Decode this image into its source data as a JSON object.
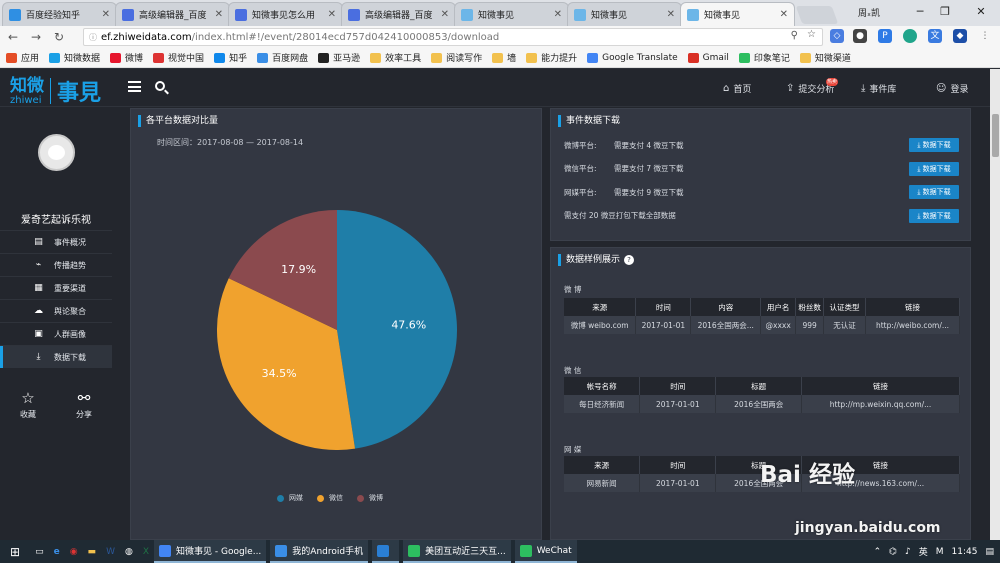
{
  "browser": {
    "tabs": [
      {
        "label": "百度经验知乎",
        "color": "#2f8fe3"
      },
      {
        "label": "高级编辑器_百度",
        "color": "#4a6ee0"
      },
      {
        "label": "知微事见怎么用",
        "color": "#4a6ee0"
      },
      {
        "label": "高级编辑器_百度",
        "color": "#4a6ee0"
      },
      {
        "label": "知微事见",
        "color": "#6cb6e8"
      },
      {
        "label": "知微事见",
        "color": "#6cb6e8"
      },
      {
        "label": "知微事见",
        "color": "#6cb6e8"
      }
    ],
    "user": "周ₓ凯",
    "url_host": "ef.zhiweidata.com",
    "url_path": "/index.html#!/event/28014ecd757d042410000853/download",
    "bookmarks": [
      {
        "label": "应用",
        "color": "#e44d26"
      },
      {
        "label": "知微数据",
        "color": "#1aa0e6"
      },
      {
        "label": "微博",
        "color": "#e6162d"
      },
      {
        "label": "视觉中国",
        "color": "#d33"
      },
      {
        "label": "知乎",
        "color": "#0f88eb"
      },
      {
        "label": "百度网盘",
        "color": "#3a8ee6"
      },
      {
        "label": "亚马逊",
        "color": "#222"
      },
      {
        "label": "效率工具",
        "color": "#f2c14e"
      },
      {
        "label": "阅读写作",
        "color": "#f2c14e"
      },
      {
        "label": "墙",
        "color": "#f2c14e"
      },
      {
        "label": "能力提升",
        "color": "#f2c14e"
      },
      {
        "label": "Google Translate",
        "color": "#4285f4"
      },
      {
        "label": "Gmail",
        "color": "#d93025"
      },
      {
        "label": "印象笔记",
        "color": "#2dbe60"
      },
      {
        "label": "知微渠道",
        "color": "#f2c14e"
      }
    ]
  },
  "app": {
    "logo": {
      "cn": "知微",
      "en": "zhiwei",
      "product": "事見"
    },
    "nav": {
      "home": "首页",
      "submit": "提交分析",
      "badge": "热卖",
      "library": "事件库",
      "login": "登录"
    },
    "username": "爱奇艺起诉乐视",
    "sidebar_items": [
      "事件概况",
      "传播趋势",
      "重要渠道",
      "舆论聚合",
      "人群画像",
      "数据下载"
    ],
    "sidebar_extra": [
      "收藏",
      "分享"
    ],
    "p1": {
      "title": "各平台数据对比量",
      "range": "时间区间：2017-08-08 — 2017-08-14"
    },
    "p2": {
      "title": "事件数据下载",
      "rows": [
        {
          "platform": "微博平台:",
          "desc": "需要支付 4 微豆下载",
          "btn": "数据下载"
        },
        {
          "platform": "微信平台:",
          "desc": "需要支付 7 微豆下载",
          "btn": "数据下载"
        },
        {
          "platform": "网媒平台:",
          "desc": "需要支付 9 微豆下载",
          "btn": "数据下载"
        },
        {
          "platform": "",
          "desc": "需支付 20 微豆打包下载全部数据",
          "btn": "数据下载"
        }
      ]
    },
    "p3": {
      "title": "数据样例展示",
      "weibo": {
        "label": "微 博",
        "headers": [
          "来源",
          "时间",
          "内容",
          "用户名",
          "粉丝数",
          "认证类型",
          "链接"
        ],
        "row": [
          "微博 weibo.com",
          "2017-01-01",
          "2016全国两会...",
          "@xxxx",
          "999",
          "无认证",
          "http://weibo.com/..."
        ]
      },
      "weixin": {
        "label": "微 信",
        "headers": [
          "帐号名称",
          "时间",
          "标题",
          "链接"
        ],
        "row": [
          "每日经济新闻",
          "2017-01-01",
          "2016全国两会",
          "http://mp.weixin.qq.com/..."
        ]
      },
      "wangmei": {
        "label": "网 媒",
        "headers": [
          "来源",
          "时间",
          "标题",
          "链接"
        ],
        "row": [
          "网易新闻",
          "2017-01-01",
          "2016全国两会",
          "http://news.163.com/..."
        ]
      }
    }
  },
  "chart_data": {
    "type": "pie",
    "title": "各平台数据对比量",
    "slices": [
      {
        "name": "网媒",
        "value": 47.6,
        "label": "47.6%",
        "color": "#1f7ea8"
      },
      {
        "name": "微信",
        "value": 34.5,
        "label": "34.5%",
        "color": "#f0a22e"
      },
      {
        "name": "微博",
        "value": 17.9,
        "label": "17.9%",
        "color": "#8b4a4e"
      }
    ],
    "legend_position": "bottom"
  },
  "taskbar": {
    "items": [
      {
        "label": "知微事见 - Google...",
        "color": "#4285f4"
      },
      {
        "label": "我的Android手机",
        "color": "#3a8ee6"
      },
      {
        "label": "",
        "color": "#2a7fd4"
      },
      {
        "label": "美团互动近三天互...",
        "color": "#2dbe60"
      },
      {
        "label": "WeChat",
        "color": "#2dbe60"
      }
    ],
    "ime": "英",
    "time": "11:45"
  },
  "watermark": {
    "logo": "Bai 经验",
    "url": "jingyan.baidu.com"
  }
}
